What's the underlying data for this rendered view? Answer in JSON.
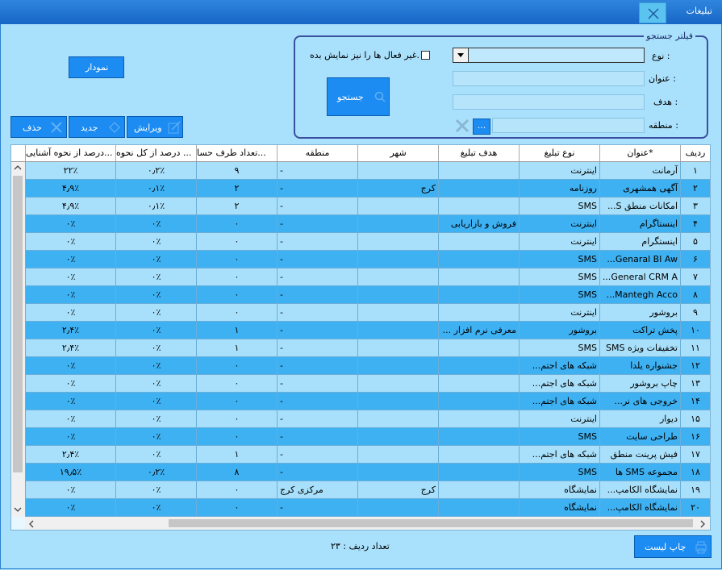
{
  "window": {
    "title": "تبلیغات"
  },
  "filter": {
    "legend": "فیلتر جستجو",
    "type_label": "نوع :",
    "title_label": "عنوان :",
    "target_label": "هدف :",
    "region_label": "منطقه :",
    "inactive_label": "غیر فعال ها را نیز نمایش بده.",
    "search_button": "جستجو",
    "ellipsis_button": "..."
  },
  "toolbar": {
    "chart_button": "نمودار",
    "edit_button": "ویرایش",
    "new_button": "جدید",
    "delete_button": "حذف"
  },
  "columns": [
    "ردیف",
    "عنوان*",
    "نوع تبلیغ",
    "هدف تبلیغ",
    "شهر",
    "منطقه",
    "تعداد طرف حسا...",
    "درصد از کل نحوه ...",
    "درصد از نحوه آشنایی..."
  ],
  "rows": [
    [
      "۱",
      "آرمانت",
      "اینترنت",
      "",
      "",
      "-",
      "۹",
      "۰٫۲٪",
      "۲۲٪"
    ],
    [
      "۲",
      "آگهی همشهری",
      "روزنامه",
      "",
      "کرج",
      "-",
      "۲",
      "۰٫۱٪",
      "۴٫۹٪"
    ],
    [
      "۳",
      "امکانات منطق S...",
      "SMS",
      "",
      "",
      "-",
      "۲",
      "۰٫۱٪",
      "۴٫۹٪"
    ],
    [
      "۴",
      "اینستاگرام",
      "اینترنت",
      "فروش و بازاریابی",
      "",
      "-",
      "۰",
      "۰٪",
      "۰٪"
    ],
    [
      "۵",
      "اینستگرام",
      "اینترنت",
      "",
      "",
      "-",
      "۰",
      "۰٪",
      "۰٪"
    ],
    [
      "۶",
      "Genaral BI Aw...",
      "SMS",
      "",
      "",
      "-",
      "۰",
      "۰٪",
      "۰٪"
    ],
    [
      "۷",
      "General CRM A...",
      "SMS",
      "",
      "",
      "-",
      "۰",
      "۰٪",
      "۰٪"
    ],
    [
      "۸",
      "Mantegh Acco...",
      "SMS",
      "",
      "",
      "-",
      "۰",
      "۰٪",
      "۰٪"
    ],
    [
      "۹",
      "بروشور",
      "اینترنت",
      "",
      "",
      "-",
      "۰",
      "۰٪",
      "۰٪"
    ],
    [
      "۱۰",
      "پخش تراکت",
      "بروشور",
      "معرفی نرم افزار ...",
      "",
      "-",
      "۱",
      "۰٪",
      "۲٫۴٪"
    ],
    [
      "۱۱",
      "تخفیفات ویژه SMS",
      "SMS",
      "",
      "",
      "-",
      "۱",
      "۰٪",
      "۲٫۴٪"
    ],
    [
      "۱۲",
      "جشنواره یلدا",
      "شبکه های اجتم...",
      "",
      "",
      "-",
      "۰",
      "۰٪",
      "۰٪"
    ],
    [
      "۱۳",
      "چاپ بروشور",
      "شبکه های اجتم...",
      "",
      "",
      "-",
      "۰",
      "۰٪",
      "۰٪"
    ],
    [
      "۱۴",
      "خروجی های نر...",
      "شبکه های اجتم...",
      "",
      "",
      "-",
      "۰",
      "۰٪",
      "۰٪"
    ],
    [
      "۱۵",
      "دیوار",
      "اینترنت",
      "",
      "",
      "-",
      "۰",
      "۰٪",
      "۰٪"
    ],
    [
      "۱۶",
      "طراحی سایت",
      "SMS",
      "",
      "",
      "-",
      "۰",
      "۰٪",
      "۰٪"
    ],
    [
      "۱۷",
      "فیش پرینت منطق",
      "شبکه های اجتم...",
      "",
      "",
      "-",
      "۱",
      "۰٪",
      "۲٫۴٪"
    ],
    [
      "۱۸",
      "مجموعه SMS ها",
      "SMS",
      "",
      "",
      "-",
      "۸",
      "۰٫۲٪",
      "۱۹٫۵٪"
    ],
    [
      "۱۹",
      "نمایشگاه الکامپ...",
      "نمایشگاه",
      "",
      "کرج",
      "مرکزی کرج",
      "۰",
      "۰٪",
      "۰٪"
    ],
    [
      "۲۰",
      "نمایشگاه الکامپ...",
      "نمایشگاه",
      "",
      "",
      "-",
      "۰",
      "۰٪",
      "۰٪"
    ]
  ],
  "footer": {
    "row_count": "تعداد ردیف : ۲۳",
    "print_button": "چاپ لیست"
  },
  "colors": {
    "row_light": "#a8e0fb",
    "row_dark": "#3eb1f2",
    "button": "#1c8cf2"
  }
}
